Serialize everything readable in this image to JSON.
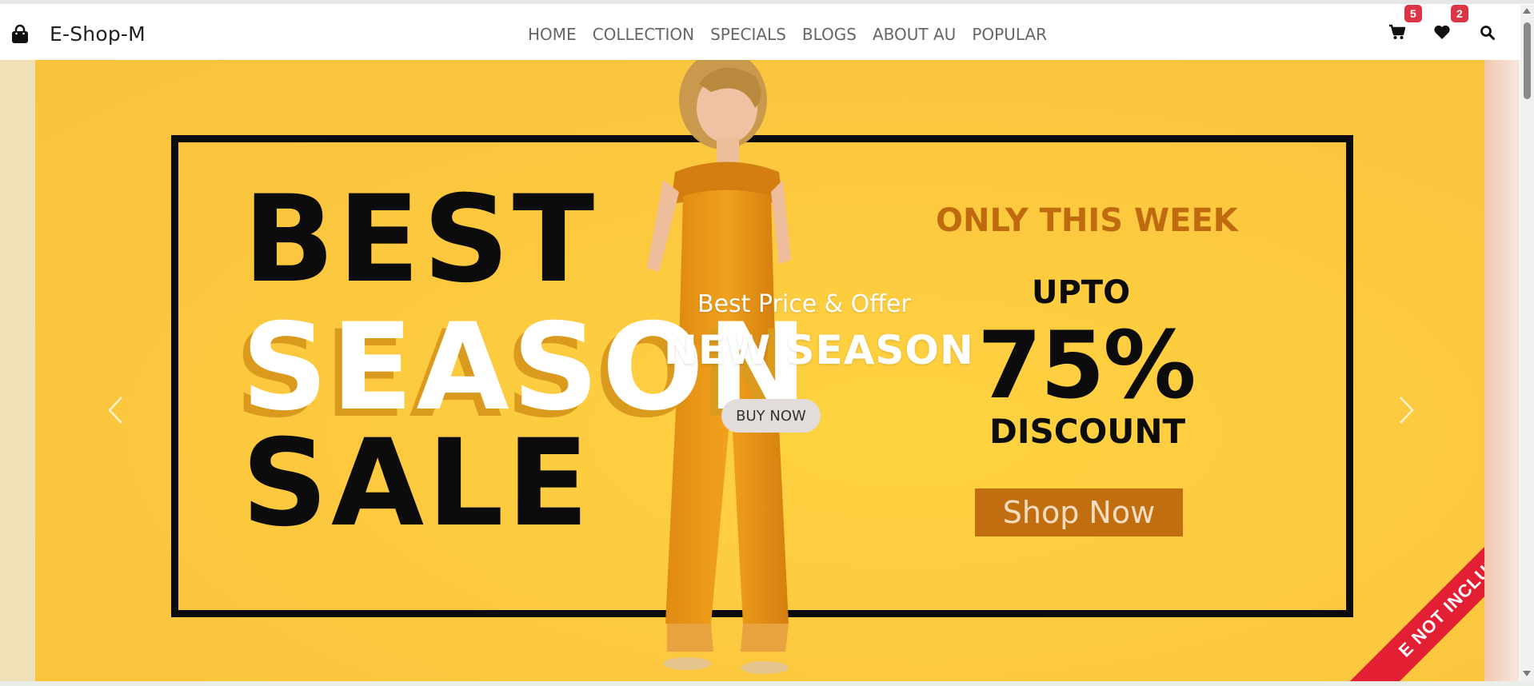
{
  "brand": {
    "name": "E-Shop-M",
    "icon": "shopping-bag-icon"
  },
  "nav": {
    "links": [
      "HOME",
      "COLLECTION",
      "SPECIALS",
      "BLOGS",
      "ABOUT AU",
      "POPULAR"
    ]
  },
  "header_icons": {
    "cart": {
      "icon": "cart-icon",
      "count": "5"
    },
    "wishlist": {
      "icon": "heart-icon",
      "count": "2"
    },
    "search": {
      "icon": "search-icon"
    }
  },
  "banner": {
    "line1": "BEST",
    "line2": "SEASON",
    "line3": "SALE",
    "only_week": "ONLY THIS WEEK",
    "upto": "UPTO",
    "percent": "75%",
    "discount": "DISCOUNT",
    "shop_now": "Shop Now",
    "ribbon": "E NOT INCLUDED"
  },
  "carousel": {
    "caption_sub": "Best Price & Offer",
    "caption_title": "NEW SEASON",
    "button": "BUY NOW",
    "prev_icon": "chevron-left-icon",
    "next_icon": "chevron-right-icon"
  },
  "colors": {
    "banner_yellow": "#fcc93f",
    "accent_orange": "#c16e11",
    "badge_red": "#dc3545",
    "ribbon_red": "#e21f33"
  }
}
